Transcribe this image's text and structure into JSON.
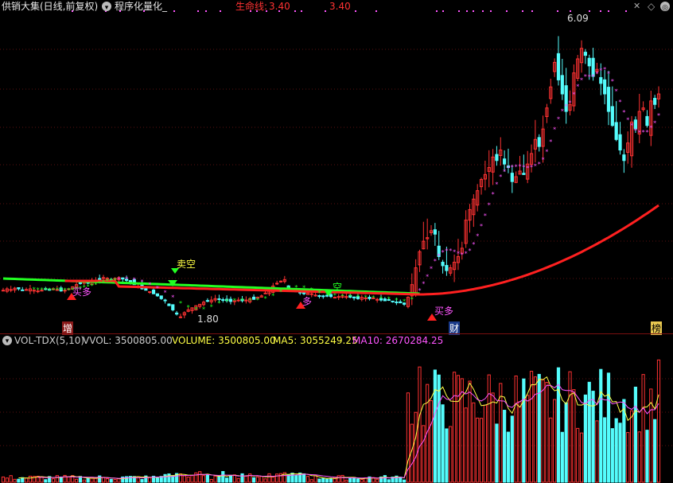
{
  "header": {
    "title": "供销大集(日线,前复权)",
    "formula_name": "程序化量化_",
    "lifeline_label": "生命线:",
    "lifeline_value": "3.40",
    "lifeline_value2": "3.40",
    "close_glyph": "✕",
    "nav_glyph": "◇"
  },
  "markers": {
    "high_label": "6.09",
    "low_label": "1.80",
    "sell_short_label": "卖空",
    "buy_long_label_1": "买多",
    "buy_long_label_2": "多",
    "buy_long_label_3": "买多",
    "short_label": "空",
    "event_zeng": "增",
    "event_cai": "财",
    "event_bang": "榜"
  },
  "volume_panel": {
    "indicator_name": "VOL-TDX(5,10)",
    "vvol_label": "VVOL: 3500805.00",
    "volume_label": "VOLUME: 3500805.00",
    "ma5_label": "MA5: 3055249.25",
    "ma10_label": "MA10: 2670284.25"
  },
  "colors": {
    "up": "#ff3232",
    "down": "#54fcfc",
    "lifeline": "#ff2020",
    "green_line": "#22ff22",
    "star_line": "#ff55ff",
    "ma5": "#ffff44",
    "ma10": "#ff55ff"
  },
  "chart_data": {
    "type": "candlestick",
    "price_range": [
      1.8,
      6.09
    ],
    "volume_range": [
      0,
      3600000
    ],
    "closes": [
      2.2,
      2.22,
      2.21,
      2.23,
      2.22,
      2.2,
      2.21,
      2.22,
      2.2,
      2.19,
      2.2,
      2.21,
      2.2,
      2.22,
      2.21,
      2.19,
      2.2,
      2.22,
      2.25,
      2.28,
      2.3,
      2.32,
      2.3,
      2.33,
      2.34,
      2.36,
      2.38,
      2.37,
      2.35,
      2.37,
      2.38,
      2.36,
      2.34,
      2.32,
      2.28,
      2.26,
      2.22,
      2.2,
      2.18,
      2.15,
      2.12,
      2.08,
      2.05,
      1.98,
      1.92,
      1.86,
      1.82,
      1.88,
      1.92,
      1.95,
      1.98,
      2.0,
      2.03,
      2.05,
      2.06,
      2.08,
      2.07,
      2.06,
      2.05,
      2.04,
      2.05,
      2.06,
      2.05,
      2.06,
      2.08,
      2.07,
      2.1,
      2.12,
      2.16,
      2.2,
      2.26,
      2.3,
      2.33,
      2.35,
      2.22,
      2.2,
      2.18,
      2.16,
      2.15,
      2.16,
      2.15,
      2.13,
      2.12,
      2.11,
      2.12,
      2.11,
      2.1,
      2.11,
      2.12,
      2.11,
      2.1,
      2.09,
      2.08,
      2.1,
      2.09,
      2.08,
      2.09,
      2.07,
      2.06,
      2.05,
      2.06,
      2.04,
      2.03,
      2.02,
      2.0,
      2.1,
      2.28,
      2.52,
      2.75,
      2.9,
      2.95,
      3.05,
      3.0,
      2.68,
      2.55,
      2.48,
      2.52,
      2.6,
      2.68,
      2.8,
      3.2,
      3.35,
      3.5,
      3.62,
      3.78,
      3.85,
      3.95,
      4.1,
      4.05,
      4.2,
      4.0,
      3.95,
      3.75,
      3.82,
      3.9,
      3.85,
      4.0,
      4.15,
      4.35,
      4.25,
      4.5,
      4.8,
      5.1,
      5.45,
      5.2,
      5.0,
      4.75,
      4.85,
      5.3,
      5.5,
      5.65,
      5.55,
      5.4,
      5.25,
      5.35,
      5.15,
      5.0,
      4.75,
      4.55,
      4.35,
      4.2,
      4.05,
      4.3,
      4.6,
      4.5,
      4.75,
      4.8,
      4.55,
      4.9,
      4.85,
      5.0
    ]
  }
}
